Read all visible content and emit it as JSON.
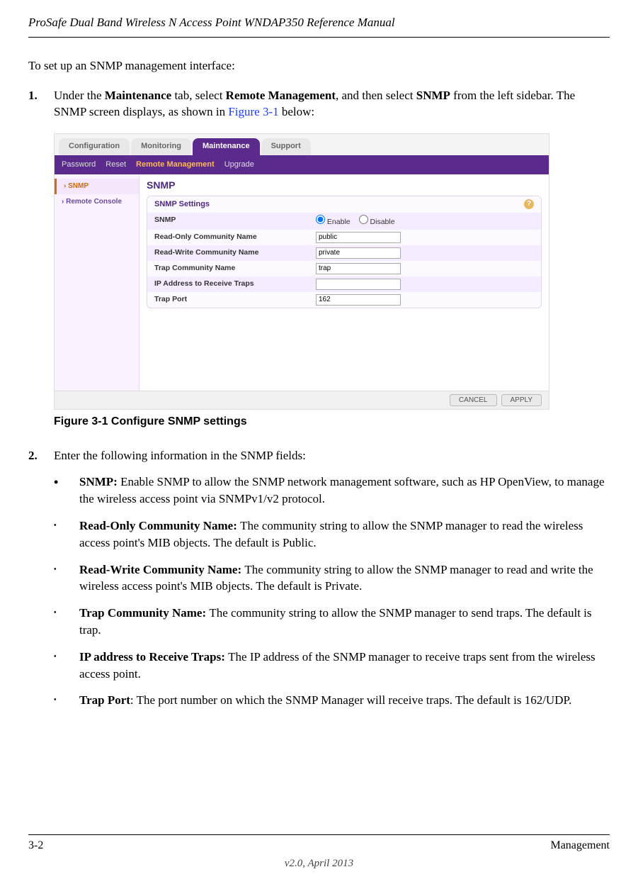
{
  "header_title": "ProSafe Dual Band Wireless N Access Point WNDAP350 Reference Manual",
  "intro": "To set up an SNMP management interface:",
  "step1": {
    "num": "1.",
    "text_pre": "Under the ",
    "b1": "Maintenance",
    "text_mid1": " tab, select ",
    "b2": "Remote Management",
    "text_mid2": ", and then select ",
    "b3": "SNMP",
    "text_mid3": " from the left sidebar. The SNMP screen displays, as shown in ",
    "link": "Figure 3-1",
    "text_end": " below:"
  },
  "figure_caption": "Figure 3-1  Configure SNMP settings",
  "step2": {
    "num": "2.",
    "text": "Enter the following information in the SNMP fields:"
  },
  "bullets": [
    {
      "mark": "•",
      "bold": "SNMP: ",
      "rest": "Enable SNMP to allow the SNMP network management software, such as HP OpenView, to manage the wireless access point via SNMPv1/v2 protocol."
    },
    {
      "mark": "•",
      "bold": "Read-Only Community Name: ",
      "rest": "The community string to allow the SNMP manager to read the wireless access point's MIB objects. The default is Public."
    },
    {
      "mark": "•",
      "bold": "Read-Write Community Name: ",
      "rest": "The community string to allow the SNMP manager to read and write the wireless access point's MIB objects. The default is Private."
    },
    {
      "mark": "•",
      "bold": "Trap Community Name: ",
      "rest": "The community string to allow the SNMP manager to send traps. The default is trap."
    },
    {
      "mark": "•",
      "bold": "IP address to Receive Traps: ",
      "rest": "The IP address of the SNMP manager to receive traps sent from the wireless access point."
    },
    {
      "mark": "•",
      "bold": "Trap Port",
      "rest": ": The port number on which the SNMP Manager will receive traps. The default is 162/UDP."
    }
  ],
  "footer": {
    "page": "3-2",
    "section": "Management",
    "version": "v2.0, April 2013"
  },
  "screenshot": {
    "top_tabs": [
      "Configuration",
      "Monitoring",
      "Maintenance",
      "Support"
    ],
    "active_top": "Maintenance",
    "sub_tabs": [
      "Password",
      "Reset",
      "Remote Management",
      "Upgrade"
    ],
    "active_sub": "Remote Management",
    "sidebar": [
      "SNMP",
      "Remote Console"
    ],
    "active_side": "SNMP",
    "panel_title": "SNMP",
    "legend": "SNMP Settings",
    "fields": {
      "snmp_label": "SNMP",
      "enable": "Enable",
      "disable": "Disable",
      "ro_label": "Read-Only Community Name",
      "ro_val": "public",
      "rw_label": "Read-Write Community Name",
      "rw_val": "private",
      "trap_label": "Trap Community Name",
      "trap_val": "trap",
      "ip_label": "IP Address to Receive Traps",
      "ip_val": "",
      "port_label": "Trap Port",
      "port_val": "162"
    },
    "buttons": {
      "cancel": "CANCEL",
      "apply": "APPLY"
    }
  }
}
